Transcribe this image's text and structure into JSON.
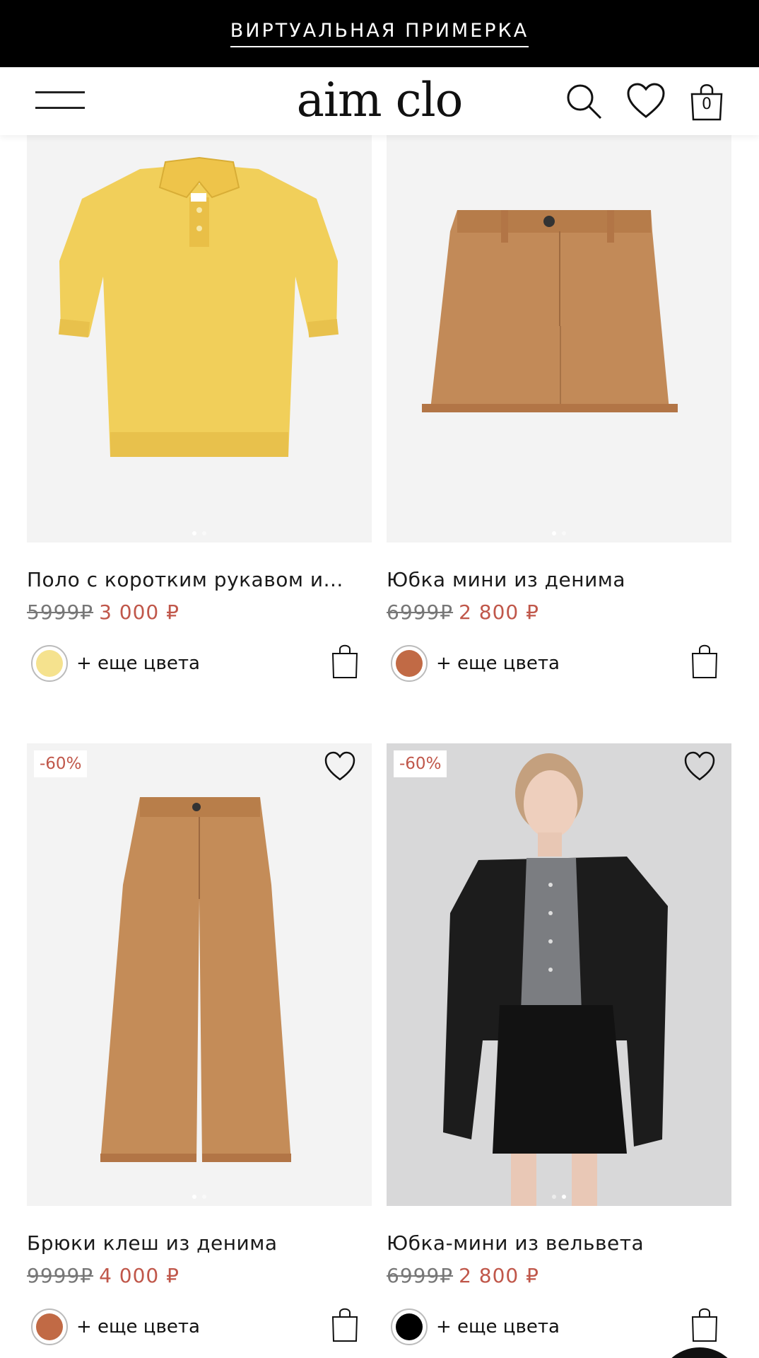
{
  "banner": {
    "text": "ВИРТУАЛЬНАЯ ПРИМЕРКА"
  },
  "header": {
    "logo": "aim clo",
    "cart_count": "0"
  },
  "colors": {
    "sale_red": "#c0574a",
    "banner_bg": "#000000"
  },
  "products": [
    {
      "title": "Поло с коротким рукавом и...",
      "old_price": "5999₽",
      "new_price": "3 000 ₽",
      "discount": "",
      "swatch_color": "#f5e28e",
      "more_colors": "+ еще цвета",
      "garment": "polo"
    },
    {
      "title": "Юбка мини из денима",
      "old_price": "6999₽",
      "new_price": "2 800 ₽",
      "discount": "",
      "swatch_color": "#c16a45",
      "more_colors": "+ еще цвета",
      "garment": "skirt"
    },
    {
      "title": "Брюки клеш из денима",
      "old_price": "9999₽",
      "new_price": "4 000 ₽",
      "discount": "-60%",
      "swatch_color": "#c16a45",
      "more_colors": "+ еще цвета",
      "garment": "pants"
    },
    {
      "title": "Юбка-мини из вельвета",
      "old_price": "6999₽",
      "new_price": "2 800 ₽",
      "discount": "-60%",
      "swatch_color": "#000000",
      "more_colors": "+ еще цвета",
      "garment": "model"
    }
  ]
}
